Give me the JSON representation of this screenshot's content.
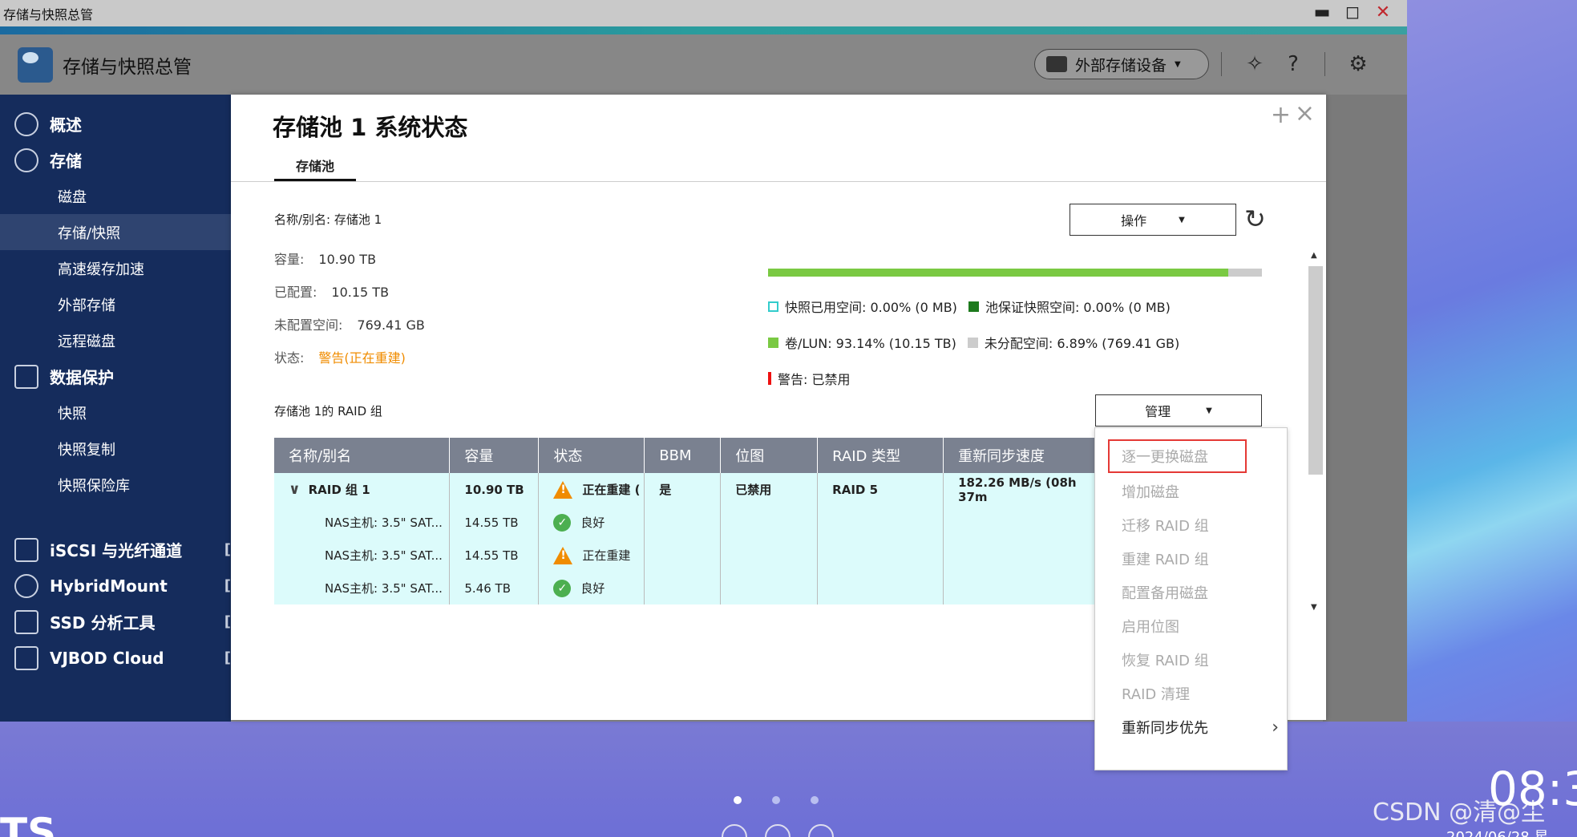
{
  "window": {
    "title": "存储与快照总管",
    "minimize": "▬",
    "maximize": "◻",
    "close": "✕"
  },
  "app": {
    "name": "存储与快照总管",
    "external_storage_button": "外部存储设备"
  },
  "sidebar": {
    "sections": [
      {
        "label": "概述",
        "icon": "dashboard-icon"
      },
      {
        "label": "存储",
        "icon": "database-icon"
      }
    ],
    "storage_items": [
      "磁盘",
      "存储/快照",
      "高速缓存加速",
      "外部存储",
      "远程磁盘"
    ],
    "data_protection": "数据保护",
    "protection_items": [
      "快照",
      "快照复制",
      "快照保险库"
    ],
    "bottom_items": [
      "iSCSI 与光纤通道",
      "HybridMount",
      "SSD 分析工具",
      "VJBOD Cloud"
    ]
  },
  "dialog": {
    "title": "存储池 1 系统状态",
    "tab": "存储池",
    "name_label": "名称/别名: 存储池 1",
    "capacity_label": "容量:",
    "capacity_value": "10.90 TB",
    "allocated_label": "已配置:",
    "allocated_value": "10.15 TB",
    "unallocated_label": "未配置空间:",
    "unallocated_value": "769.41 GB",
    "status_label": "状态:",
    "status_value": "警告(正在重建)",
    "operate_button": "操作",
    "usage_fraction": 0.9314,
    "legend": {
      "snapshot_used": "快照已用空间: 0.00% (0 MB)",
      "pool_guarantee": "池保证快照空间: 0.00% (0 MB)",
      "volume_lun": "卷/LUN: 93.14% (10.15 TB)",
      "unallocated": "未分配空间: 6.89% (769.41 GB)",
      "warning": "警告: 已禁用"
    },
    "raid_group_title": "存储池 1的 RAID 组",
    "manage_button": "管理",
    "table": {
      "headers": [
        "名称/别名",
        "容量",
        "状态",
        "BBM",
        "位图",
        "RAID 类型",
        "重新同步速度"
      ],
      "rows": [
        {
          "name": "RAID 组 1",
          "capacity": "10.90 TB",
          "status": "正在重建 (",
          "bbm": "是",
          "bitmap": "已禁用",
          "raid": "RAID 5",
          "speed": "182.26 MB/s (08h 37m"
        },
        {
          "name": "NAS主机: 3.5\" SAT...",
          "capacity": "14.55 TB",
          "status": "良好"
        },
        {
          "name": "NAS主机: 3.5\" SAT...",
          "capacity": "14.55 TB",
          "status": "正在重建"
        },
        {
          "name": "NAS主机: 3.5\" SAT...",
          "capacity": "5.46 TB",
          "status": "良好"
        }
      ]
    }
  },
  "manage_menu": {
    "items": [
      "逐一更换磁盘",
      "增加磁盘",
      "迁移 RAID 组",
      "重建 RAID 组",
      "配置备用磁盘",
      "启用位图",
      "恢复 RAID 组",
      "RAID 清理",
      "重新同步优先"
    ]
  },
  "desktop": {
    "clock": "08:3",
    "date": "2024/06/28 星",
    "watermark": "CSDN @清@尘",
    "logo_text": "TS"
  }
}
